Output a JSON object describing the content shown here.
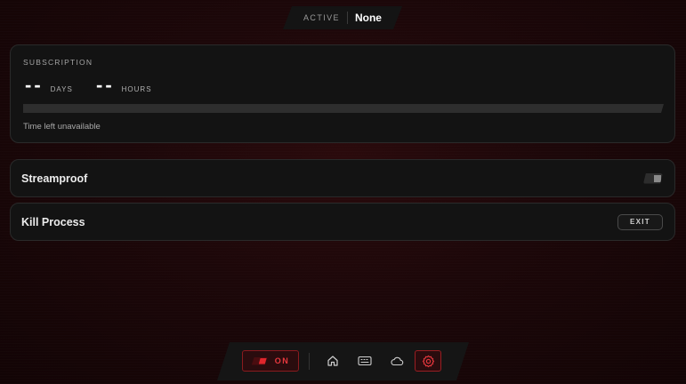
{
  "status": {
    "label": "ACTIVE",
    "value": "None"
  },
  "subscription": {
    "title": "SUBSCRIPTION",
    "days_value": "--",
    "days_unit": "DAYS",
    "hours_value": "--",
    "hours_unit": "HOURS",
    "progress": 0,
    "time_left_text": "Time left unavailable"
  },
  "rows": {
    "streamproof": {
      "label": "Streamproof",
      "toggle_on": false
    },
    "kill_process": {
      "label": "Kill Process",
      "button_label": "EXIT"
    }
  },
  "dock": {
    "power_label": "ON",
    "icons": [
      "home-icon",
      "keyboard-icon",
      "cloud-icon",
      "gear-icon"
    ],
    "active_icon": "gear-icon"
  },
  "colors": {
    "accent": "#e0262c",
    "panel": "#131313",
    "background": "#1c0709"
  }
}
